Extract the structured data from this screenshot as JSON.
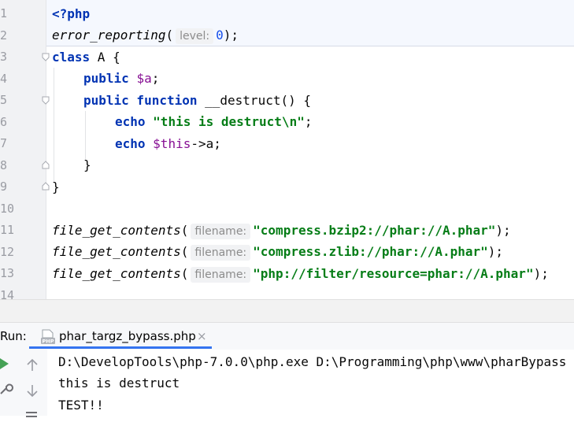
{
  "editor": {
    "line_numbers": [
      "1",
      "2",
      "3",
      "4",
      "5",
      "6",
      "7",
      "8",
      "9",
      "10",
      "11",
      "12",
      "13",
      "14"
    ],
    "code": {
      "l1": "<?php",
      "l2_fn": "error_reporting",
      "l2_hint": "level:",
      "l2_val": "0",
      "l3_kw": "class",
      "l3_name": " A {",
      "l4_kw": "public",
      "l4_var": "$a",
      "l5_kw": "public function",
      "l5_rest": " __destruct() {",
      "l6_kw": "echo",
      "l6_str": "\"this is destruct\\n\"",
      "l7_kw": "echo",
      "l7_var": "$this",
      "l7_rest": "->a;",
      "l8": "}",
      "l9": "}",
      "l11_fn": "file_get_contents",
      "l11_hint": "filename:",
      "l11_str": "\"compress.bzip2://phar://A.phar\"",
      "l12_fn": "file_get_contents",
      "l12_hint": "filename:",
      "l12_str": "\"compress.zlib://phar://A.phar\"",
      "l13_fn": "file_get_contents",
      "l13_hint": "filename:",
      "l13_str": "\"php://filter/resource=phar://A.phar\""
    }
  },
  "run": {
    "label": "Run:",
    "tab_name": "phar_targz_bypass.php",
    "close_glyph": "×",
    "output": [
      "D:\\DevelopTools\\php-7.0.0\\php.exe D:\\Programming\\php\\www\\pharBypass",
      "this is destruct",
      "TEST!!"
    ]
  },
  "icons": {
    "run": "play-icon",
    "wrench": "wrench-icon",
    "up": "arrow-up-icon",
    "down": "arrow-down-icon",
    "menu": "menu-icon",
    "php": "php-file-icon"
  },
  "colors": {
    "keyword": "#0033b3",
    "variable": "#871094",
    "string": "#067d17",
    "number": "#1750eb",
    "run_green": "#45a155",
    "tab_accent": "#3574f0"
  }
}
